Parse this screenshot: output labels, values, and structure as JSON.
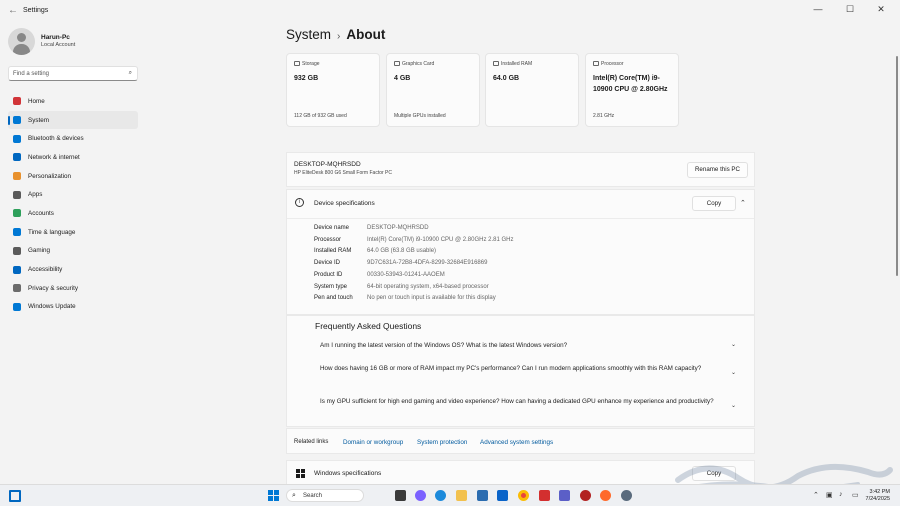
{
  "window": {
    "title": "Settings",
    "back": "←",
    "minimize": "—",
    "maximize": "☐",
    "close": "✕"
  },
  "profile": {
    "name": "Harun-Pc",
    "account": "Local Account"
  },
  "search": {
    "placeholder": "Find a setting"
  },
  "nav": [
    {
      "label": "Home",
      "icon": "home-icon",
      "color": "#d13438"
    },
    {
      "label": "System",
      "icon": "system-icon",
      "color": "#0078d4",
      "active": true
    },
    {
      "label": "Bluetooth & devices",
      "icon": "bluetooth-icon",
      "color": "#0078d4"
    },
    {
      "label": "Network & internet",
      "icon": "wifi-icon",
      "color": "#0067c0"
    },
    {
      "label": "Personalization",
      "icon": "brush-icon",
      "color": "#e8912d"
    },
    {
      "label": "Apps",
      "icon": "apps-icon",
      "color": "#5a5a5a"
    },
    {
      "label": "Accounts",
      "icon": "accounts-icon",
      "color": "#2d9f5a"
    },
    {
      "label": "Time & language",
      "icon": "globe-icon",
      "color": "#0078d4"
    },
    {
      "label": "Gaming",
      "icon": "gaming-icon",
      "color": "#5a5a5a"
    },
    {
      "label": "Accessibility",
      "icon": "accessibility-icon",
      "color": "#0067c0"
    },
    {
      "label": "Privacy & security",
      "icon": "shield-icon",
      "color": "#6b6b6b"
    },
    {
      "label": "Windows Update",
      "icon": "update-icon",
      "color": "#0078d4"
    }
  ],
  "breadcrumb": {
    "parent": "System",
    "separator": "›",
    "current": "About"
  },
  "cards": [
    {
      "label": "Storage",
      "value": "932 GB",
      "sub": "112 GB of 932 GB used"
    },
    {
      "label": "Graphics Card",
      "value": "4 GB",
      "sub": "Multiple GPUs installed"
    },
    {
      "label": "Installed RAM",
      "value": "64.0 GB",
      "sub": ""
    },
    {
      "label": "Processor",
      "value": "Intel(R) Core(TM) i9-10900 CPU @ 2.80GHz",
      "sub": "2.81 GHz"
    }
  ],
  "pc": {
    "hostname": "DESKTOP-MQHRSDD",
    "model": "HP EliteDesk 800 G6 Small Form Factor PC",
    "rename": "Rename this PC"
  },
  "specs": {
    "title": "Device specifications",
    "copy": "Copy",
    "rows": [
      {
        "key": "Device name",
        "value": "DESKTOP-MQHRSDD"
      },
      {
        "key": "Processor",
        "value": "Intel(R) Core(TM) i9-10900 CPU @ 2.80GHz   2.81 GHz"
      },
      {
        "key": "Installed RAM",
        "value": "64.0 GB (63.8 GB usable)"
      },
      {
        "key": "Device ID",
        "value": "9D7C631A-72B8-4DFA-8299-32684E916869"
      },
      {
        "key": "Product ID",
        "value": "00330-53943-01241-AAOEM"
      },
      {
        "key": "System type",
        "value": "64-bit operating system, x64-based processor"
      },
      {
        "key": "Pen and touch",
        "value": "No pen or touch input is available for this display"
      }
    ]
  },
  "faq": {
    "title": "Frequently Asked Questions",
    "items": [
      "Am I running the latest version of the Windows OS? What is the latest Windows version?",
      "How does having 16 GB or more of RAM impact my PC's performance? Can I run modern applications smoothly with this RAM capacity?",
      "Is my GPU sufficient for high end gaming and video experience? How can having a dedicated GPU enhance my experience and productivity?"
    ]
  },
  "related": {
    "label": "Related links",
    "links": [
      "Domain or workgroup",
      "System protection",
      "Advanced system settings"
    ]
  },
  "winspec": {
    "title": "Windows specifications",
    "copy": "Copy"
  },
  "taskbar": {
    "search": "Search",
    "time": "3:42 PM",
    "date": "7/24/2025"
  }
}
